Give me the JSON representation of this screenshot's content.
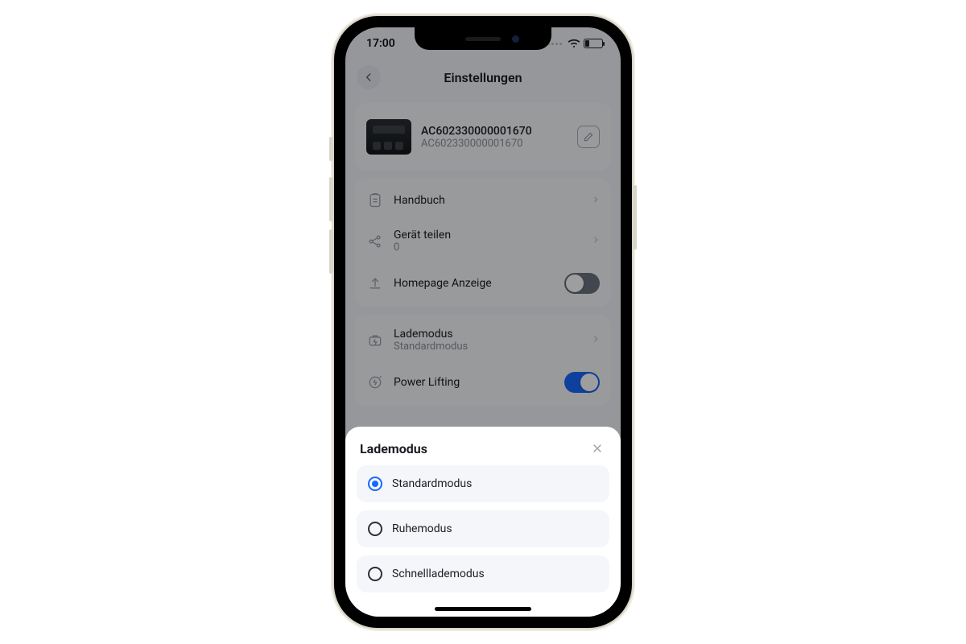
{
  "statusbar": {
    "time": "17:00"
  },
  "header": {
    "title": "Einstellungen"
  },
  "device": {
    "name": "AC602330000001670",
    "sub": "AC602330000001670"
  },
  "rows": {
    "manual": {
      "label": "Handbuch"
    },
    "share": {
      "label": "Gerät teilen",
      "count": "0"
    },
    "homepage": {
      "label": "Homepage Anzeige"
    },
    "chargeMode": {
      "label": "Lademodus",
      "value": "Standardmodus"
    },
    "powerLifting": {
      "label": "Power Lifting"
    }
  },
  "sheet": {
    "title": "Lademodus",
    "options": [
      {
        "label": "Standardmodus",
        "selected": true
      },
      {
        "label": "Ruhemodus",
        "selected": false
      },
      {
        "label": "Schnelllademodus",
        "selected": false
      }
    ]
  }
}
